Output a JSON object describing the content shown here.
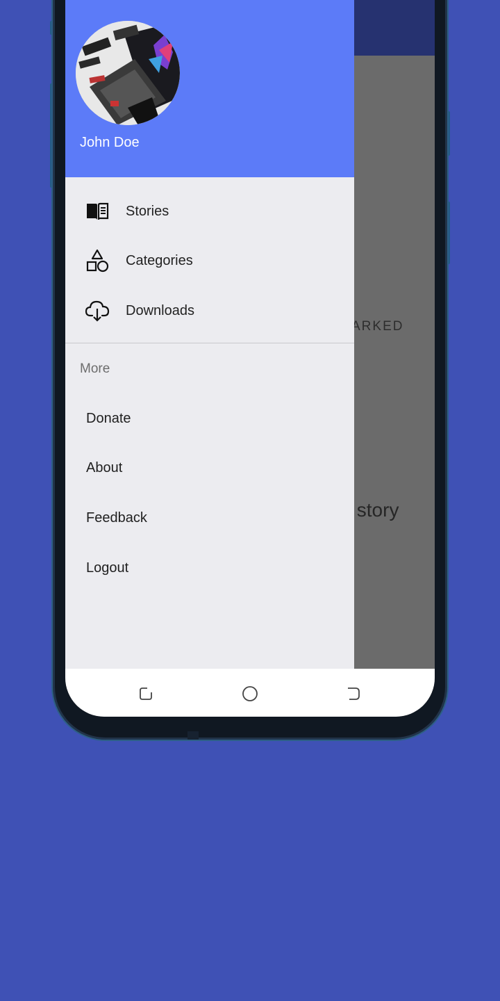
{
  "drawer": {
    "user_name": "John Doe",
    "items": [
      {
        "label": "Stories",
        "icon": "book-icon"
      },
      {
        "label": "Categories",
        "icon": "shapes-icon"
      },
      {
        "label": "Downloads",
        "icon": "cloud-download-icon"
      }
    ],
    "more_section": {
      "title": "More",
      "items": [
        "Donate",
        "About",
        "Feedback",
        "Logout"
      ]
    }
  },
  "background_app": {
    "partial_label": "ARKED",
    "partial_text": "story"
  },
  "colors": {
    "page_background": "#3f51b5",
    "drawer_header": "#5c7bf8",
    "app_bar": "#263270",
    "drawer_body": "#ececf0",
    "scrim": "#6b6b6b"
  }
}
